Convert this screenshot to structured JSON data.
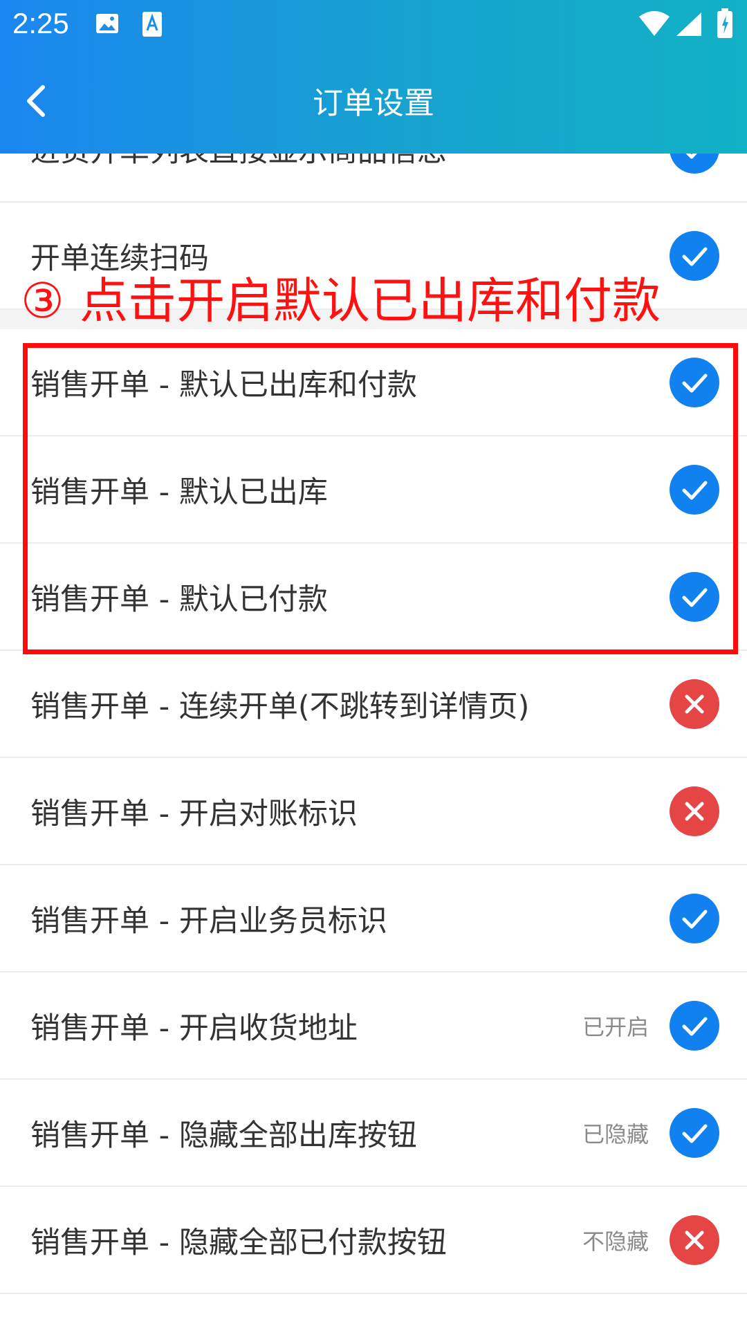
{
  "status_bar": {
    "time": "2:25"
  },
  "header": {
    "title": "订单设置"
  },
  "annotation": {
    "text": "③ 点击开启默认已出库和付款"
  },
  "rows": [
    {
      "label": "进货开单列表直接显示商品信息",
      "status": "",
      "state": "on"
    },
    {
      "label": "开单连续扫码",
      "status": "",
      "state": "on"
    },
    {
      "label": "销售开单 - 默认已出库和付款",
      "status": "",
      "state": "on"
    },
    {
      "label": "销售开单 - 默认已出库",
      "status": "",
      "state": "on"
    },
    {
      "label": "销售开单 - 默认已付款",
      "status": "",
      "state": "on"
    },
    {
      "label": "销售开单 - 连续开单(不跳转到详情页)",
      "status": "",
      "state": "off"
    },
    {
      "label": "销售开单 - 开启对账标识",
      "status": "",
      "state": "off"
    },
    {
      "label": "销售开单 - 开启业务员标识",
      "status": "",
      "state": "on"
    },
    {
      "label": "销售开单 - 开启收货地址",
      "status": "已开启",
      "state": "on"
    },
    {
      "label": "销售开单 - 隐藏全部出库按钮",
      "status": "已隐藏",
      "state": "on"
    },
    {
      "label": "销售开单 - 隐藏全部已付款按钮",
      "status": "不隐藏",
      "state": "off"
    }
  ],
  "colors": {
    "on": "#1281f0",
    "off": "#e64545",
    "accent": "#ff0b0b"
  }
}
